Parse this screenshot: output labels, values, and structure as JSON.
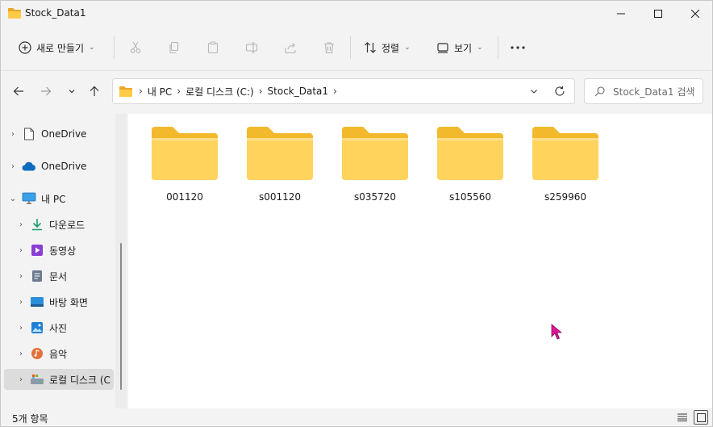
{
  "window": {
    "title": "Stock_Data1",
    "minimize_icon": "minimize-icon",
    "maximize_icon": "maximize-icon",
    "close_icon": "close-icon"
  },
  "toolbar": {
    "new_label": "새로 만들기",
    "sort_label": "정렬",
    "view_label": "보기",
    "more_icon": "more-icon"
  },
  "address": {
    "breadcrumbs": [
      "내 PC",
      "로컬 디스크 (C:)",
      "Stock_Data1"
    ],
    "search_placeholder": "Stock_Data1 검색"
  },
  "sidebar": {
    "items": [
      {
        "label": "OneDrive",
        "icon": "document-icon"
      },
      {
        "label": "OneDrive",
        "icon": "cloud-icon"
      },
      {
        "label": "내 PC",
        "icon": "computer-icon"
      },
      {
        "label": "다운로드",
        "icon": "download-icon"
      },
      {
        "label": "동영상",
        "icon": "video-icon"
      },
      {
        "label": "문서",
        "icon": "documents-icon"
      },
      {
        "label": "바탕 화면",
        "icon": "desktop-icon"
      },
      {
        "label": "사진",
        "icon": "pictures-icon"
      },
      {
        "label": "음악",
        "icon": "music-icon"
      },
      {
        "label": "로컬 디스크 (C",
        "icon": "drive-icon"
      }
    ]
  },
  "folders": [
    {
      "name": "001120"
    },
    {
      "name": "s001120"
    },
    {
      "name": "s035720"
    },
    {
      "name": "s105560"
    },
    {
      "name": "s259960"
    }
  ],
  "status": {
    "item_count": "5개 항목"
  },
  "colors": {
    "folder_back": "#f2b92d",
    "folder_front": "#ffd35c",
    "accent": "#0067c0",
    "cursor": "#e0169a"
  }
}
